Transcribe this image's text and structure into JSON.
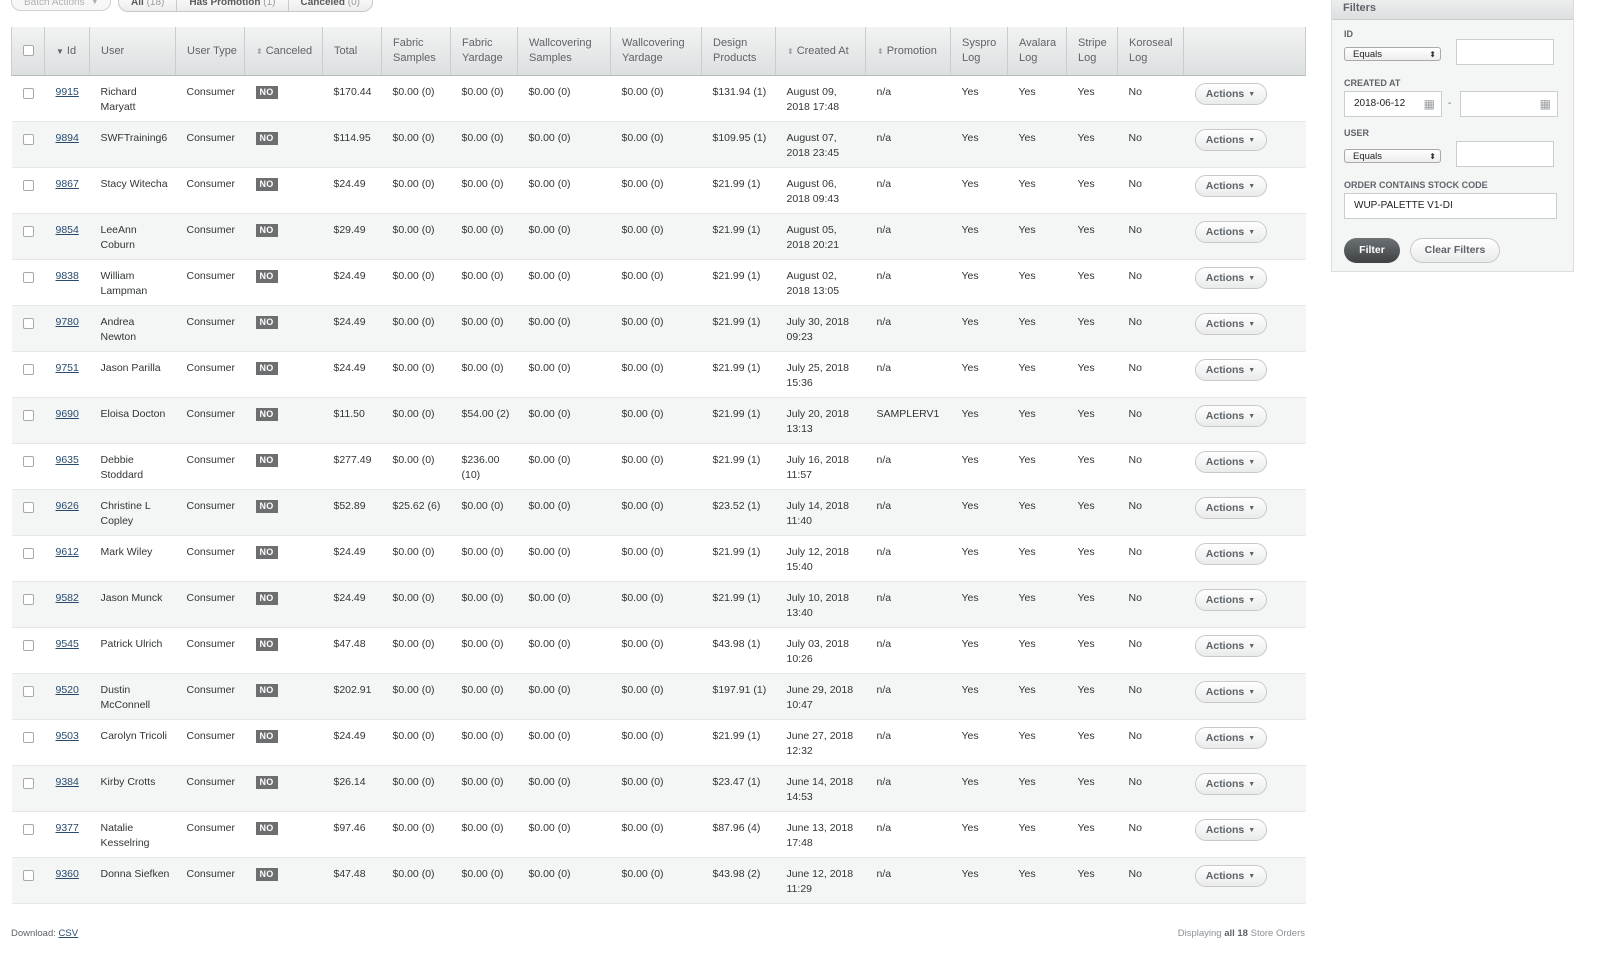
{
  "batch_actions_label": "Batch Actions",
  "scopes": [
    {
      "label": "All",
      "count": "(18)"
    },
    {
      "label": "Has Promotion",
      "count": "(1)"
    },
    {
      "label": "Canceled",
      "count": "(0)"
    }
  ],
  "columns": [
    "Id",
    "User",
    "User Type",
    "Canceled",
    "Total",
    "Fabric Samples",
    "Fabric Yardage",
    "Wallcovering Samples",
    "Wallcovering Yardage",
    "Design Products",
    "Created At",
    "Promotion",
    "Syspro Log",
    "Avalara Log",
    "Stripe Log",
    "Koroseal Log"
  ],
  "actions_label": "Actions",
  "rows": [
    {
      "id": "9915",
      "user": "Richard Maryatt",
      "user_type": "Consumer",
      "canceled": "NO",
      "total": "$170.44",
      "fabric_samples": "$0.00 (0)",
      "fabric_yardage": "$0.00 (0)",
      "wall_samples": "$0.00 (0)",
      "wall_yardage": "$0.00 (0)",
      "design_products": "$131.94 (1)",
      "created_at": "August 09, 2018 17:48",
      "promotion": "n/a",
      "syspro": "Yes",
      "avalara": "Yes",
      "stripe": "Yes",
      "koroseal": "No"
    },
    {
      "id": "9894",
      "user": "SWFTraining6",
      "user_type": "Consumer",
      "canceled": "NO",
      "total": "$114.95",
      "fabric_samples": "$0.00 (0)",
      "fabric_yardage": "$0.00 (0)",
      "wall_samples": "$0.00 (0)",
      "wall_yardage": "$0.00 (0)",
      "design_products": "$109.95 (1)",
      "created_at": "August 07, 2018 23:45",
      "promotion": "n/a",
      "syspro": "Yes",
      "avalara": "Yes",
      "stripe": "Yes",
      "koroseal": "No"
    },
    {
      "id": "9867",
      "user": "Stacy Witecha",
      "user_type": "Consumer",
      "canceled": "NO",
      "total": "$24.49",
      "fabric_samples": "$0.00 (0)",
      "fabric_yardage": "$0.00 (0)",
      "wall_samples": "$0.00 (0)",
      "wall_yardage": "$0.00 (0)",
      "design_products": "$21.99 (1)",
      "created_at": "August 06, 2018 09:43",
      "promotion": "n/a",
      "syspro": "Yes",
      "avalara": "Yes",
      "stripe": "Yes",
      "koroseal": "No"
    },
    {
      "id": "9854",
      "user": "LeeAnn Coburn",
      "user_type": "Consumer",
      "canceled": "NO",
      "total": "$29.49",
      "fabric_samples": "$0.00 (0)",
      "fabric_yardage": "$0.00 (0)",
      "wall_samples": "$0.00 (0)",
      "wall_yardage": "$0.00 (0)",
      "design_products": "$21.99 (1)",
      "created_at": "August 05, 2018 20:21",
      "promotion": "n/a",
      "syspro": "Yes",
      "avalara": "Yes",
      "stripe": "Yes",
      "koroseal": "No"
    },
    {
      "id": "9838",
      "user": "William Lampman",
      "user_type": "Consumer",
      "canceled": "NO",
      "total": "$24.49",
      "fabric_samples": "$0.00 (0)",
      "fabric_yardage": "$0.00 (0)",
      "wall_samples": "$0.00 (0)",
      "wall_yardage": "$0.00 (0)",
      "design_products": "$21.99 (1)",
      "created_at": "August 02, 2018 13:05",
      "promotion": "n/a",
      "syspro": "Yes",
      "avalara": "Yes",
      "stripe": "Yes",
      "koroseal": "No"
    },
    {
      "id": "9780",
      "user": "Andrea Newton",
      "user_type": "Consumer",
      "canceled": "NO",
      "total": "$24.49",
      "fabric_samples": "$0.00 (0)",
      "fabric_yardage": "$0.00 (0)",
      "wall_samples": "$0.00 (0)",
      "wall_yardage": "$0.00 (0)",
      "design_products": "$21.99 (1)",
      "created_at": "July 30, 2018 09:23",
      "promotion": "n/a",
      "syspro": "Yes",
      "avalara": "Yes",
      "stripe": "Yes",
      "koroseal": "No"
    },
    {
      "id": "9751",
      "user": "Jason Parilla",
      "user_type": "Consumer",
      "canceled": "NO",
      "total": "$24.49",
      "fabric_samples": "$0.00 (0)",
      "fabric_yardage": "$0.00 (0)",
      "wall_samples": "$0.00 (0)",
      "wall_yardage": "$0.00 (0)",
      "design_products": "$21.99 (1)",
      "created_at": "July 25, 2018 15:36",
      "promotion": "n/a",
      "syspro": "Yes",
      "avalara": "Yes",
      "stripe": "Yes",
      "koroseal": "No"
    },
    {
      "id": "9690",
      "user": "Eloisa Docton",
      "user_type": "Consumer",
      "canceled": "NO",
      "total": "$11.50",
      "fabric_samples": "$0.00 (0)",
      "fabric_yardage": "$54.00 (2)",
      "wall_samples": "$0.00 (0)",
      "wall_yardage": "$0.00 (0)",
      "design_products": "$21.99 (1)",
      "created_at": "July 20, 2018 13:13",
      "promotion": "SAMPLERV1",
      "syspro": "Yes",
      "avalara": "Yes",
      "stripe": "Yes",
      "koroseal": "No"
    },
    {
      "id": "9635",
      "user": "Debbie Stoddard",
      "user_type": "Consumer",
      "canceled": "NO",
      "total": "$277.49",
      "fabric_samples": "$0.00 (0)",
      "fabric_yardage": "$236.00 (10)",
      "wall_samples": "$0.00 (0)",
      "wall_yardage": "$0.00 (0)",
      "design_products": "$21.99 (1)",
      "created_at": "July 16, 2018 11:57",
      "promotion": "n/a",
      "syspro": "Yes",
      "avalara": "Yes",
      "stripe": "Yes",
      "koroseal": "No"
    },
    {
      "id": "9626",
      "user": "Christine L Copley",
      "user_type": "Consumer",
      "canceled": "NO",
      "total": "$52.89",
      "fabric_samples": "$25.62 (6)",
      "fabric_yardage": "$0.00 (0)",
      "wall_samples": "$0.00 (0)",
      "wall_yardage": "$0.00 (0)",
      "design_products": "$23.52 (1)",
      "created_at": "July 14, 2018 11:40",
      "promotion": "n/a",
      "syspro": "Yes",
      "avalara": "Yes",
      "stripe": "Yes",
      "koroseal": "No"
    },
    {
      "id": "9612",
      "user": "Mark Wiley",
      "user_type": "Consumer",
      "canceled": "NO",
      "total": "$24.49",
      "fabric_samples": "$0.00 (0)",
      "fabric_yardage": "$0.00 (0)",
      "wall_samples": "$0.00 (0)",
      "wall_yardage": "$0.00 (0)",
      "design_products": "$21.99 (1)",
      "created_at": "July 12, 2018 15:40",
      "promotion": "n/a",
      "syspro": "Yes",
      "avalara": "Yes",
      "stripe": "Yes",
      "koroseal": "No"
    },
    {
      "id": "9582",
      "user": "Jason Munck",
      "user_type": "Consumer",
      "canceled": "NO",
      "total": "$24.49",
      "fabric_samples": "$0.00 (0)",
      "fabric_yardage": "$0.00 (0)",
      "wall_samples": "$0.00 (0)",
      "wall_yardage": "$0.00 (0)",
      "design_products": "$21.99 (1)",
      "created_at": "July 10, 2018 13:40",
      "promotion": "n/a",
      "syspro": "Yes",
      "avalara": "Yes",
      "stripe": "Yes",
      "koroseal": "No"
    },
    {
      "id": "9545",
      "user": "Patrick Ulrich",
      "user_type": "Consumer",
      "canceled": "NO",
      "total": "$47.48",
      "fabric_samples": "$0.00 (0)",
      "fabric_yardage": "$0.00 (0)",
      "wall_samples": "$0.00 (0)",
      "wall_yardage": "$0.00 (0)",
      "design_products": "$43.98 (1)",
      "created_at": "July 03, 2018 10:26",
      "promotion": "n/a",
      "syspro": "Yes",
      "avalara": "Yes",
      "stripe": "Yes",
      "koroseal": "No"
    },
    {
      "id": "9520",
      "user": "Dustin McConnell",
      "user_type": "Consumer",
      "canceled": "NO",
      "total": "$202.91",
      "fabric_samples": "$0.00 (0)",
      "fabric_yardage": "$0.00 (0)",
      "wall_samples": "$0.00 (0)",
      "wall_yardage": "$0.00 (0)",
      "design_products": "$197.91 (1)",
      "created_at": "June 29, 2018 10:47",
      "promotion": "n/a",
      "syspro": "Yes",
      "avalara": "Yes",
      "stripe": "Yes",
      "koroseal": "No"
    },
    {
      "id": "9503",
      "user": "Carolyn Tricoli",
      "user_type": "Consumer",
      "canceled": "NO",
      "total": "$24.49",
      "fabric_samples": "$0.00 (0)",
      "fabric_yardage": "$0.00 (0)",
      "wall_samples": "$0.00 (0)",
      "wall_yardage": "$0.00 (0)",
      "design_products": "$21.99 (1)",
      "created_at": "June 27, 2018 12:32",
      "promotion": "n/a",
      "syspro": "Yes",
      "avalara": "Yes",
      "stripe": "Yes",
      "koroseal": "No"
    },
    {
      "id": "9384",
      "user": "Kirby Crotts",
      "user_type": "Consumer",
      "canceled": "NO",
      "total": "$26.14",
      "fabric_samples": "$0.00 (0)",
      "fabric_yardage": "$0.00 (0)",
      "wall_samples": "$0.00 (0)",
      "wall_yardage": "$0.00 (0)",
      "design_products": "$23.47 (1)",
      "created_at": "June 14, 2018 14:53",
      "promotion": "n/a",
      "syspro": "Yes",
      "avalara": "Yes",
      "stripe": "Yes",
      "koroseal": "No"
    },
    {
      "id": "9377",
      "user": "Natalie Kesselring",
      "user_type": "Consumer",
      "canceled": "NO",
      "total": "$97.46",
      "fabric_samples": "$0.00 (0)",
      "fabric_yardage": "$0.00 (0)",
      "wall_samples": "$0.00 (0)",
      "wall_yardage": "$0.00 (0)",
      "design_products": "$87.96 (4)",
      "created_at": "June 13, 2018 17:48",
      "promotion": "n/a",
      "syspro": "Yes",
      "avalara": "Yes",
      "stripe": "Yes",
      "koroseal": "No"
    },
    {
      "id": "9360",
      "user": "Donna Siefken",
      "user_type": "Consumer",
      "canceled": "NO",
      "total": "$47.48",
      "fabric_samples": "$0.00 (0)",
      "fabric_yardage": "$0.00 (0)",
      "wall_samples": "$0.00 (0)",
      "wall_yardage": "$0.00 (0)",
      "design_products": "$43.98 (2)",
      "created_at": "June 12, 2018 11:29",
      "promotion": "n/a",
      "syspro": "Yes",
      "avalara": "Yes",
      "stripe": "Yes",
      "koroseal": "No"
    }
  ],
  "footer": {
    "download_label": "Download:",
    "csv_label": "CSV",
    "displaying_prefix": "Displaying",
    "displaying_all": "all 18",
    "displaying_suffix": "Store Orders"
  },
  "filters": {
    "title": "Filters",
    "id_label": "ID",
    "id_operator": "Equals",
    "id_value": "",
    "created_at_label": "CREATED AT",
    "created_from": "2018-06-12",
    "created_to": "",
    "range_separator": "-",
    "user_label": "USER",
    "user_operator": "Equals",
    "user_value": "",
    "stock_code_label": "ORDER CONTAINS STOCK CODE",
    "stock_code_value": "WUP-PALETTE V1-DI",
    "filter_button": "Filter",
    "clear_button": "Clear Filters"
  }
}
